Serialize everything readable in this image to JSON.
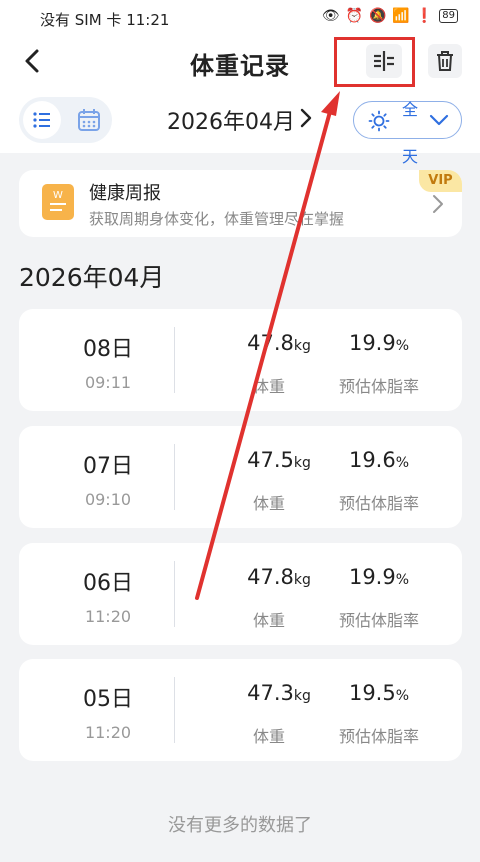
{
  "status": {
    "left": "没有 SIM 卡 11:21",
    "battery": "89"
  },
  "header": {
    "title": "体重记录"
  },
  "toolbar": {
    "month": "2026年04月",
    "period": "全天"
  },
  "banner": {
    "title": "健康周报",
    "subtitle": "获取周期身体变化，体重管理尽在掌握",
    "badge": "VIP"
  },
  "section_title": "2026年04月",
  "records": [
    {
      "day": "08日",
      "time": "09:11",
      "weight": "47.8",
      "weight_unit": "kg",
      "weight_label": "体重",
      "fat": "19.9",
      "fat_unit": "%",
      "fat_label": "预估体脂率"
    },
    {
      "day": "07日",
      "time": "09:10",
      "weight": "47.5",
      "weight_unit": "kg",
      "weight_label": "体重",
      "fat": "19.6",
      "fat_unit": "%",
      "fat_label": "预估体脂率"
    },
    {
      "day": "06日",
      "time": "11:20",
      "weight": "47.8",
      "weight_unit": "kg",
      "weight_label": "体重",
      "fat": "19.9",
      "fat_unit": "%",
      "fat_label": "预估体脂率"
    },
    {
      "day": "05日",
      "time": "11:20",
      "weight": "47.3",
      "weight_unit": "kg",
      "weight_label": "体重",
      "fat": "19.5",
      "fat_unit": "%",
      "fat_label": "预估体脂率"
    }
  ],
  "footer": "没有更多的数据了",
  "colors": {
    "accent": "#2f6fe0",
    "annotation": "#e0322f",
    "vip_bg": "#fbe7a4",
    "doc_icon": "#f7b34a"
  }
}
